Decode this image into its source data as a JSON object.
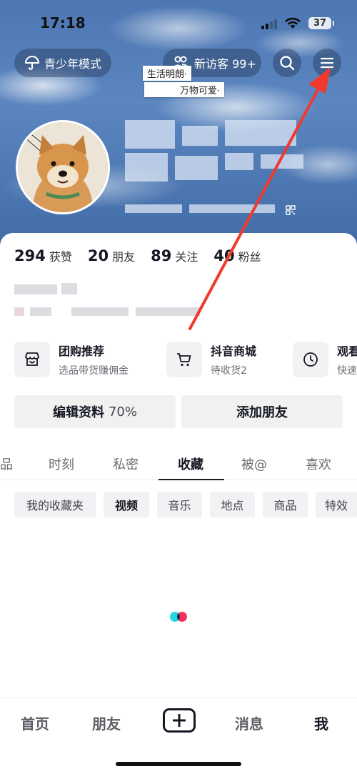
{
  "status_bar": {
    "time": "17:18",
    "battery": "37"
  },
  "header": {
    "teen_mode_label": "青少年模式",
    "new_visitors_label": "新访客 99+",
    "sticker_line1": "生活明朗·",
    "sticker_line2": "万物可爱·"
  },
  "stats": [
    {
      "value": "294",
      "label": "获赞"
    },
    {
      "value": "20",
      "label": "朋友"
    },
    {
      "value": "89",
      "label": "关注"
    },
    {
      "value": "40",
      "label": "粉丝"
    }
  ],
  "features": [
    {
      "title": "团购推荐",
      "subtitle": "选品带货赚佣金",
      "icon": "store-icon"
    },
    {
      "title": "抖音商城",
      "subtitle": "待收货2",
      "icon": "cart-icon"
    },
    {
      "title": "观看",
      "subtitle": "快速",
      "icon": "clock-icon"
    }
  ],
  "buttons": {
    "edit_profile_label": "编辑资料",
    "edit_profile_percent": "70%",
    "add_friend_label": "添加朋友"
  },
  "tabs": [
    "品",
    "时刻",
    "私密",
    "收藏",
    "被@",
    "喜欢"
  ],
  "active_tab": "收藏",
  "chips": [
    "我的收藏夹",
    "视频",
    "音乐",
    "地点",
    "商品",
    "特效"
  ],
  "active_chip": "视频",
  "bottom_nav": {
    "home": "首页",
    "friends": "朋友",
    "messages": "消息",
    "me": "我"
  },
  "colors": {
    "annotation_arrow": "#f03a2e",
    "loading_cyan": "#25d6e0",
    "loading_red": "#f5335b"
  }
}
